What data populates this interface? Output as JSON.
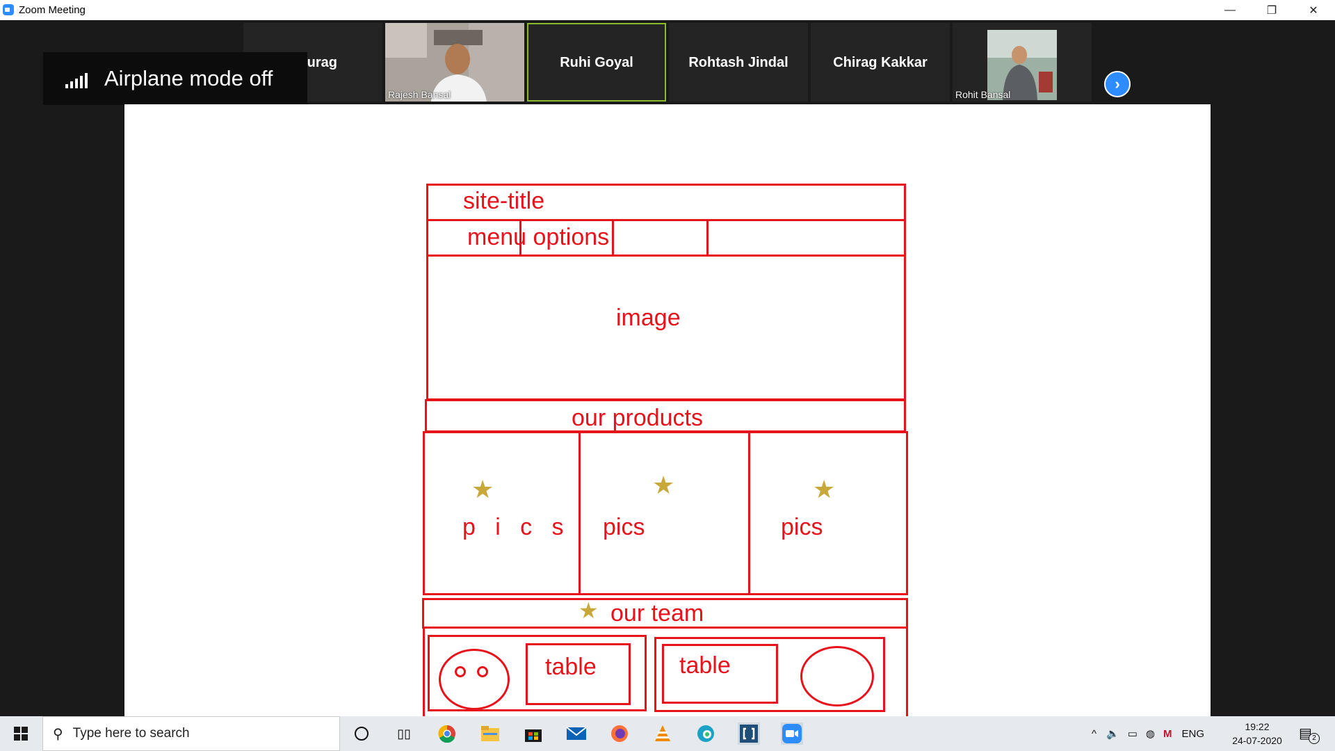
{
  "window": {
    "title": "Zoom Meeting",
    "minimize": "—",
    "restore": "❐",
    "close": "✕"
  },
  "participants": [
    {
      "name": "Anurag"
    },
    {
      "name": "Rajesh Bansal"
    },
    {
      "name": "Ruhi Goyal"
    },
    {
      "name": "Rohtash Jindal"
    },
    {
      "name": "Chirag Kakkar"
    },
    {
      "name": "Rohit Bansal"
    }
  ],
  "notification": {
    "text": "Airplane mode off"
  },
  "wireframe": {
    "site_title": "site-title",
    "menu": "menu options",
    "image": "image",
    "products": "our products",
    "pics_1": "p   i   c   s",
    "pics_2": "pics",
    "pics_3": "pics",
    "team": "our team",
    "table_1": "table",
    "table_2": "table"
  },
  "taskbar": {
    "search_placeholder": "Type here to search",
    "language": "ENG",
    "time": "19:22",
    "date": "24-07-2020",
    "notifications_count": "2"
  }
}
